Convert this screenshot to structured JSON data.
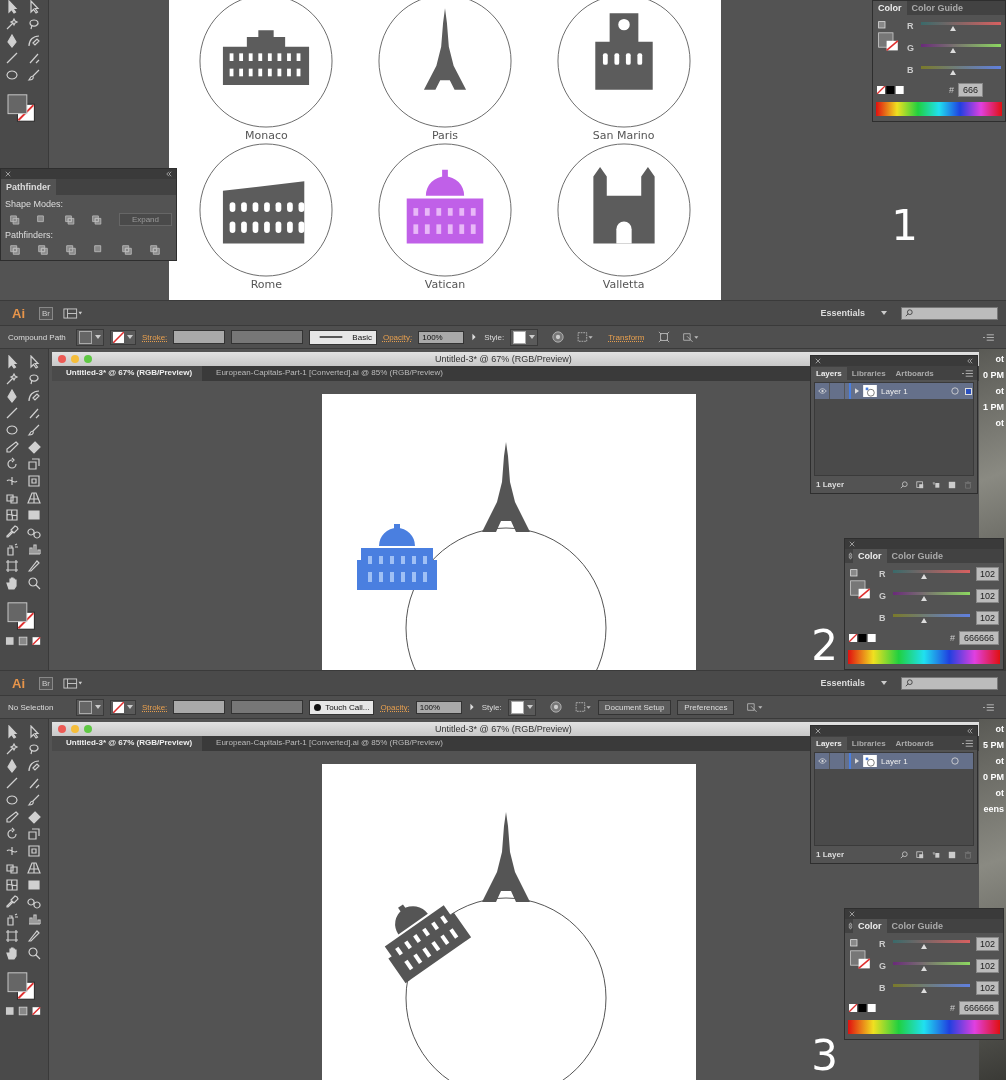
{
  "overview": {
    "landmarks": [
      {
        "label": "Monaco",
        "kind": "palace",
        "selected": false
      },
      {
        "label": "Paris",
        "kind": "tower",
        "selected": false
      },
      {
        "label": "San Marino",
        "kind": "town-hall",
        "selected": false
      },
      {
        "label": "Rome",
        "kind": "colosseum",
        "selected": false
      },
      {
        "label": "Vatican",
        "kind": "basilica",
        "selected": true
      },
      {
        "label": "Valletta",
        "kind": "church",
        "selected": false
      }
    ],
    "pathfinder": {
      "title": "Pathfinder",
      "shape_modes_label": "Shape Modes:",
      "expand_button": "Expand",
      "pathfinders_label": "Pathfinders:"
    },
    "color_panel": {
      "tabs": [
        {
          "label": "Color",
          "selected": true
        },
        {
          "label": "Color Guide",
          "selected": false
        }
      ],
      "channels": [
        {
          "name": "R",
          "level": 0.4
        },
        {
          "name": "G",
          "level": 0.4
        },
        {
          "name": "B",
          "level": 0.4
        }
      ],
      "hex_label": "#",
      "hex": "666"
    },
    "step_number": "1"
  },
  "steps": [
    {
      "app_bar": {
        "logo": "Ai",
        "bridge": "Br",
        "workspace": "Essentials"
      },
      "control_bar": {
        "selection": "Compound Path",
        "stroke_label": "Stroke:",
        "brush": {
          "label": "Basic",
          "kind": "line"
        },
        "opacity_label": "Opacity:",
        "opacity": "100%",
        "style_label": "Style:",
        "actions": [
          {
            "label": "Transform",
            "kind": "link"
          }
        ]
      },
      "document": {
        "title": "Untitled-3* @ 67% (RGB/Preview)",
        "tabs": [
          {
            "label": "Untitled-3* @ 67% (RGB/Preview)",
            "selected": true
          },
          {
            "label": "European-Capitals-Part-1 [Converted].ai @ 85% (RGB/Preview)",
            "selected": false
          }
        ],
        "basilica": {
          "selected": true,
          "kind": "beside"
        }
      },
      "layers_panel": {
        "tabs": [
          {
            "label": "Layers",
            "selected": true
          },
          {
            "label": "Libraries",
            "selected": false
          },
          {
            "label": "Artboards",
            "selected": false
          }
        ],
        "layers": [
          {
            "name": "Layer 1",
            "visible": true,
            "has_selection": true
          }
        ],
        "count": "1 Layer"
      },
      "color_panel": {
        "tabs": [
          {
            "label": "Color",
            "selected": true
          },
          {
            "label": "Color Guide",
            "selected": false
          }
        ],
        "channels": [
          {
            "name": "R",
            "value": "102",
            "level": 0.4
          },
          {
            "name": "G",
            "value": "102",
            "level": 0.4
          },
          {
            "name": "B",
            "value": "102",
            "level": 0.4
          }
        ],
        "hex_label": "#",
        "hex": "666666"
      },
      "step_number": "2",
      "desktop_labels": [
        "ot",
        "0 PM",
        "ot",
        "1 PM",
        "ot"
      ]
    },
    {
      "app_bar": {
        "logo": "Ai",
        "bridge": "Br",
        "workspace": "Essentials"
      },
      "control_bar": {
        "selection": "No Selection",
        "stroke_label": "Stroke:",
        "brush": {
          "label": "Touch Call...",
          "kind": "dot"
        },
        "opacity_label": "Opacity:",
        "opacity": "100%",
        "style_label": "Style:",
        "actions": [
          {
            "label": "Document Setup",
            "kind": "button"
          },
          {
            "label": "Preferences",
            "kind": "button"
          }
        ]
      },
      "document": {
        "title": "Untitled-3* @ 67% (RGB/Preview)",
        "tabs": [
          {
            "label": "Untitled-3* @ 67% (RGB/Preview)",
            "selected": true
          },
          {
            "label": "European-Capitals-Part-1 [Converted].ai @ 85% (RGB/Preview)",
            "selected": false
          }
        ],
        "basilica": {
          "selected": false,
          "kind": "tilted"
        }
      },
      "layers_panel": {
        "tabs": [
          {
            "label": "Layers",
            "selected": true
          },
          {
            "label": "Libraries",
            "selected": false
          },
          {
            "label": "Artboards",
            "selected": false
          }
        ],
        "layers": [
          {
            "name": "Layer 1",
            "visible": true,
            "has_selection": false
          }
        ],
        "count": "1 Layer"
      },
      "color_panel": {
        "tabs": [
          {
            "label": "Color",
            "selected": true
          },
          {
            "label": "Color Guide",
            "selected": false
          }
        ],
        "channels": [
          {
            "name": "R",
            "value": "102",
            "level": 0.4
          },
          {
            "name": "G",
            "value": "102",
            "level": 0.4
          },
          {
            "name": "B",
            "value": "102",
            "level": 0.4
          }
        ],
        "hex_label": "#",
        "hex": "666666"
      },
      "step_number": "3",
      "desktop_labels": [
        "ot",
        "5 PM",
        "ot",
        "0 PM",
        "ot",
        "eens"
      ]
    }
  ]
}
